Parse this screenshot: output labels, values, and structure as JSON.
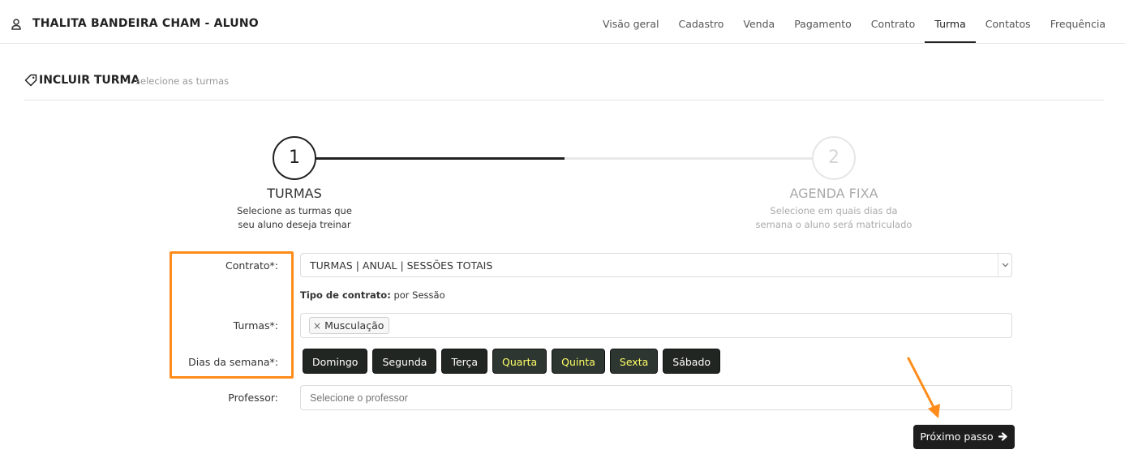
{
  "header": {
    "student_name": "THALITA BANDEIRA CHAM - ALUNO",
    "user_icon": "user-icon",
    "nav": [
      {
        "label": "Visão geral"
      },
      {
        "label": "Cadastro"
      },
      {
        "label": "Venda"
      },
      {
        "label": "Pagamento"
      },
      {
        "label": "Contrato"
      },
      {
        "label": "Turma",
        "active": true
      },
      {
        "label": "Contatos"
      },
      {
        "label": "Frequência"
      }
    ]
  },
  "section": {
    "icon": "tag-icon",
    "title": "INCLUIR TURMA",
    "subtitle": "selecione as turmas"
  },
  "stepper": {
    "steps": [
      {
        "number": "1",
        "title": "TURMAS",
        "desc_line1": "Selecione as turmas que",
        "desc_line2": "seu aluno deseja treinar",
        "active": true
      },
      {
        "number": "2",
        "title": "AGENDA FIXA",
        "desc_line1": "Selecione em quais dias da",
        "desc_line2": "semana o aluno será matriculado",
        "active": false
      }
    ]
  },
  "form": {
    "contrato_label": "Contrato*:",
    "contrato_value": "TURMAS | ANUAL | SESSÕES TOTAIS",
    "contract_type_label": "Tipo de contrato:",
    "contract_type_value": "por Sessão",
    "turmas_label": "Turmas*:",
    "turmas_selected": [
      {
        "label": "Musculação",
        "remove": "×"
      }
    ],
    "dias_label": "Dias da semana*:",
    "days": [
      {
        "label": "Domingo",
        "selected": false
      },
      {
        "label": "Segunda",
        "selected": false
      },
      {
        "label": "Terça",
        "selected": false
      },
      {
        "label": "Quarta",
        "selected": true
      },
      {
        "label": "Quinta",
        "selected": true
      },
      {
        "label": "Sexta",
        "selected": true
      },
      {
        "label": "Sábado",
        "selected": false
      }
    ],
    "professor_label": "Professor:",
    "professor_placeholder": "Selecione o professor",
    "next_label": "Próximo passo"
  },
  "colors": {
    "annotation": "#ff8c1a",
    "selected_day_text": "#ffff66",
    "dark_button": "#222623"
  }
}
